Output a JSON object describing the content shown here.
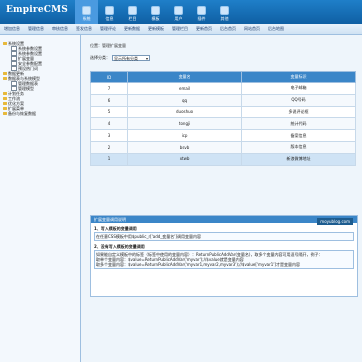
{
  "app": {
    "logo": "EmpireCMS"
  },
  "topnav": [
    {
      "label": "系统",
      "icon": "system-icon",
      "active": true
    },
    {
      "label": "信息",
      "icon": "info-icon",
      "active": false
    },
    {
      "label": "栏目",
      "icon": "column-icon",
      "active": false
    },
    {
      "label": "模板",
      "icon": "template-icon",
      "active": false
    },
    {
      "label": "用户",
      "icon": "user-icon",
      "active": false
    },
    {
      "label": "插件",
      "icon": "plugin-icon",
      "active": false
    },
    {
      "label": "其他",
      "icon": "other-icon",
      "active": false
    }
  ],
  "subnav": [
    "增加信息",
    "管理信息",
    "审核信息",
    "签发信息",
    "管理评论",
    "更新数据",
    "更新模板",
    "管理栏目",
    "更新首页",
    "后台首页",
    "网站首页",
    "后台地图"
  ],
  "sidebar": {
    "nodes": [
      {
        "label": "系统设置",
        "level": 0,
        "type": "folder"
      },
      {
        "label": "系统参数设置",
        "level": 2,
        "type": "page"
      },
      {
        "label": "系统参数设置",
        "level": 2,
        "type": "page"
      },
      {
        "label": "扩展变量",
        "level": 2,
        "type": "page"
      },
      {
        "label": "安全参数配置",
        "level": 2,
        "type": "page"
      },
      {
        "label": "预设热门词",
        "level": 2,
        "type": "page"
      },
      {
        "label": "数据更新",
        "level": 0,
        "type": "folder"
      },
      {
        "label": "数据表与系统模型",
        "level": 0,
        "type": "folder"
      },
      {
        "label": "管理数据表",
        "level": 2,
        "type": "page"
      },
      {
        "label": "管理模型",
        "level": 2,
        "type": "page"
      },
      {
        "label": "计划任务",
        "level": 0,
        "type": "folder"
      },
      {
        "label": "工作流",
        "level": 0,
        "type": "folder"
      },
      {
        "label": "优化方案",
        "level": 0,
        "type": "folder"
      },
      {
        "label": "扩展菜单",
        "level": 0,
        "type": "folder"
      },
      {
        "label": "备份与恢复数据",
        "level": 0,
        "type": "folder"
      }
    ]
  },
  "main": {
    "crumb": "位置：管理扩展变量",
    "filter_label": "选择分类：",
    "filter_value": "显示所有分类",
    "table": {
      "headers": [
        "ID",
        "变量名",
        "变量标识"
      ],
      "rows": [
        [
          "7",
          "email",
          "电子邮箱"
        ],
        [
          "6",
          "qq",
          "QQ号码"
        ],
        [
          "5",
          "duoshuo",
          "多说评论框"
        ],
        [
          "4",
          "tongji",
          "统计代码"
        ],
        [
          "3",
          "icp",
          "备案信息"
        ],
        [
          "2",
          "bsvb",
          "版本信息"
        ],
        [
          "1",
          "xtwb",
          "新浪微博地址"
        ]
      ],
      "selected_row": 6
    },
    "panel": {
      "title": "扩展变量调用说明",
      "watermark": "moyublog.com",
      "s1_title": "1、写入模板的变量调用",
      "s1_body": "在任意CSS模板中用$public_r['add_变量名']调用变量内容",
      "s2_title": "2、没有写入模板的变量调用",
      "s2_body_a": "如果能自定义模板中的标签（标签中使用的变量内容）：ReturnPublicAddVar(变量名)，取多个变量内容可用逗号隔开，例子：",
      "s2_body_b": "取单个变量内容：$value=ReturnPublicAddVar('myvar');//$value就是变量内容",
      "s2_body_c": "取多个变量内容：$value=ReturnPublicAddVar('myvar1,myvar2,myvar3');//$value['myvar1']才是变量内容"
    }
  }
}
